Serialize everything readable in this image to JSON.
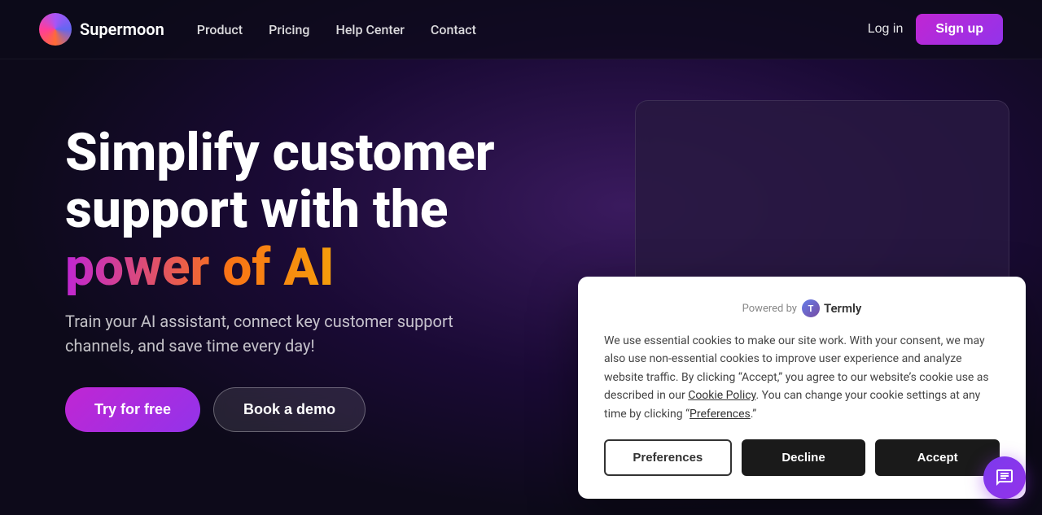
{
  "brand": {
    "name": "Supermoon",
    "logo_alt": "Supermoon logo"
  },
  "navbar": {
    "links": [
      {
        "label": "Product",
        "id": "product"
      },
      {
        "label": "Pricing",
        "id": "pricing"
      },
      {
        "label": "Help Center",
        "id": "help-center"
      },
      {
        "label": "Contact",
        "id": "contact"
      }
    ],
    "login_label": "Log in",
    "signup_label": "Sign up"
  },
  "hero": {
    "title_line1": "Simplify customer",
    "title_line2": "support with the",
    "title_gradient": "power of AI",
    "subtitle": "Train your AI assistant, connect key customer support channels, and save time every day!",
    "cta_primary": "Try for free",
    "cta_secondary": "Book a demo"
  },
  "cookie_banner": {
    "powered_by_label": "Powered by",
    "provider_name": "Termly",
    "body_text": "We use essential cookies to make our site work. With your consent, we may also use non-essential cookies to improve user experience and analyze website traffic. By clicking “Accept,” you agree to our website’s cookie use as described in our ",
    "policy_link_text": "Cookie Policy",
    "body_suffix": ". You can change your cookie settings at any time by clicking “",
    "preferences_link": "Preferences",
    "body_end": ".”",
    "btn_preferences": "Preferences",
    "btn_decline": "Decline",
    "btn_accept": "Accept"
  },
  "chat": {
    "icon": "💬"
  }
}
